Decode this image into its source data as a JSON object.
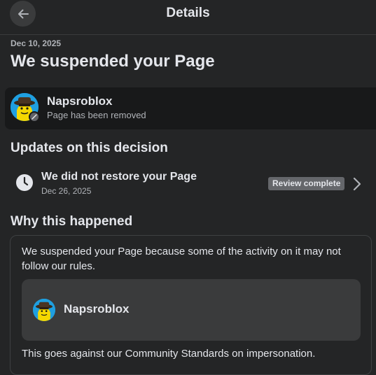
{
  "header": {
    "title": "Details"
  },
  "notice": {
    "date": "Dec 10, 2025",
    "title": "We suspended your Page"
  },
  "page": {
    "name": "Napsroblox",
    "status": "Page has been removed"
  },
  "updates": {
    "section_title": "Updates on this decision",
    "item": {
      "title": "We did not restore your Page",
      "date": "Dec 26, 2025",
      "badge": "Review complete"
    }
  },
  "why": {
    "section_title": "Why this happened",
    "text": "We suspended your Page because some of the activity on it may not follow our rules.",
    "page_name": "Napsroblox",
    "standards_text": "This goes against our Community Standards on impersonation."
  },
  "colors": {
    "background": "#242526",
    "card_dark": "#18191a",
    "avatar_blue": "#1f9fe0",
    "badge_grey": "#65676b"
  }
}
